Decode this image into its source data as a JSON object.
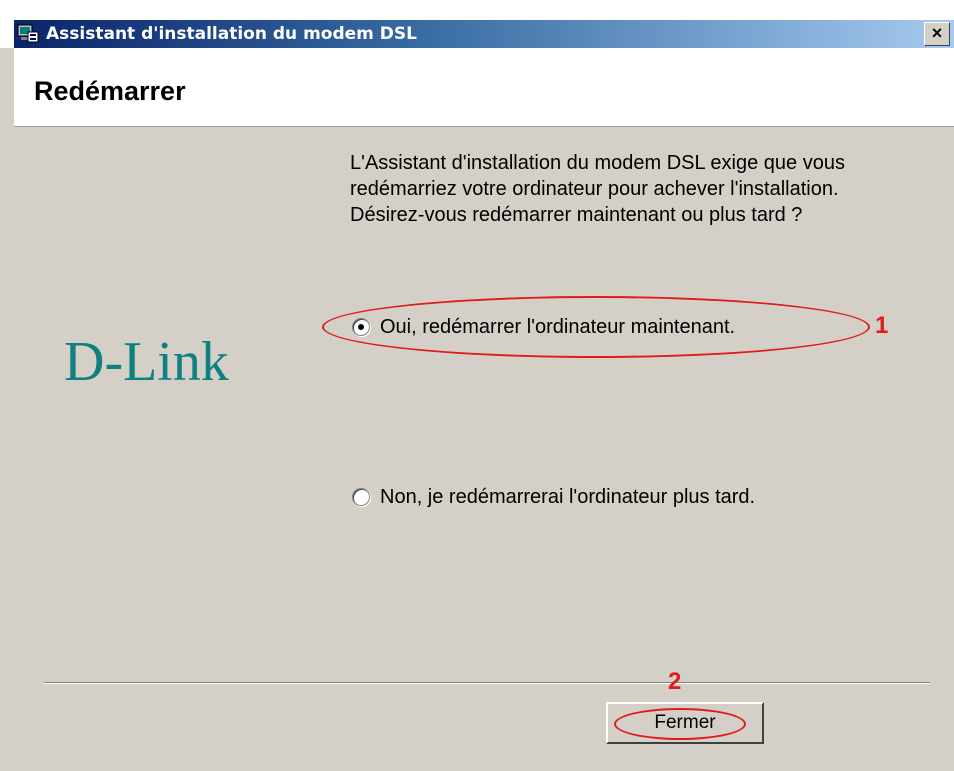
{
  "window": {
    "title": "Assistant d'installation du modem DSL",
    "close_label": "×"
  },
  "header": {
    "title": "Redémarrer"
  },
  "logo": {
    "text": "D-Link",
    "color": "#0f8080"
  },
  "body": {
    "description": "L'Assistant d'installation du modem DSL exige que vous redémarriez votre ordinateur pour achever l'installation. Désirez-vous redémarrer maintenant ou plus tard ?"
  },
  "options": [
    {
      "label": "Oui, redémarrer l'ordinateur maintenant.",
      "selected": true
    },
    {
      "label": "Non, je redémarrerai l'ordinateur plus tard.",
      "selected": false
    }
  ],
  "buttons": {
    "close_label": "Fermer"
  },
  "annotations": {
    "marker_1": "1",
    "marker_2": "2",
    "color": "#e11a1a"
  }
}
